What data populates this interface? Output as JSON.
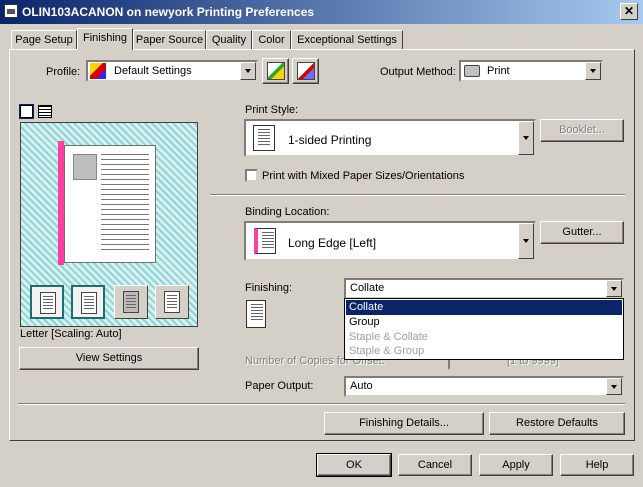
{
  "window": {
    "title": "OLIN103ACANON on newyork Printing Preferences",
    "close_glyph": "✕"
  },
  "tabs": [
    {
      "label": "Page Setup"
    },
    {
      "label": "Finishing"
    },
    {
      "label": "Paper Source"
    },
    {
      "label": "Quality"
    },
    {
      "label": "Color"
    },
    {
      "label": "Exceptional Settings"
    }
  ],
  "profile": {
    "label": "Profile:",
    "value": "Default Settings"
  },
  "output_method": {
    "label": "Output Method:",
    "value": "Print"
  },
  "preview": {
    "caption": "Letter [Scaling: Auto]",
    "view_settings_label": "View Settings"
  },
  "print_style": {
    "label": "Print Style:",
    "value": "1-sided Printing",
    "booklet_label": "Booklet..."
  },
  "mixed_sizes": {
    "label": "Print with Mixed Paper Sizes/Orientations",
    "checked": false
  },
  "binding": {
    "label": "Binding Location:",
    "value": "Long Edge [Left]",
    "gutter_label": "Gutter..."
  },
  "finishing": {
    "label": "Finishing:",
    "value": "Collate",
    "options": [
      "Collate",
      "Group",
      "Staple & Collate",
      "Staple & Group"
    ]
  },
  "offset": {
    "label": "Number of Copies for Offset:",
    "range": "[1 to 9999]"
  },
  "paper_output": {
    "label": "Paper Output:",
    "value": "Auto"
  },
  "buttons": {
    "finishing_details": "Finishing Details...",
    "restore_defaults": "Restore Defaults",
    "ok": "OK",
    "cancel": "Cancel",
    "apply": "Apply",
    "help": "Help"
  },
  "colors": {
    "title_start": "#0a246a",
    "title_end": "#a6caf0",
    "selected_item": "#0a246a",
    "binding_mark": "#ff3fa0",
    "preview_hatch": "#8fd3d3"
  }
}
